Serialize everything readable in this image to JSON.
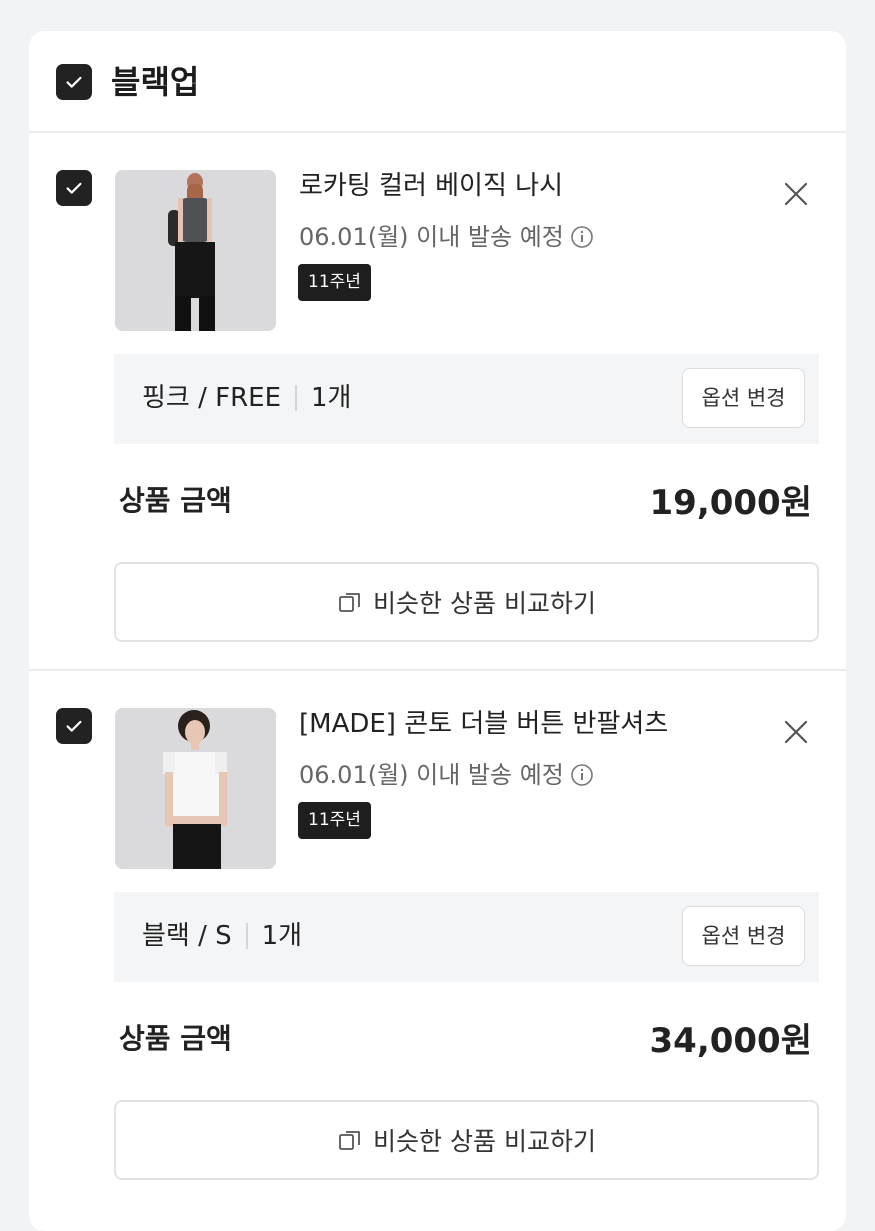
{
  "store": {
    "name": "블랙업",
    "checked": true
  },
  "items": [
    {
      "name": "로카팅 컬러 베이직 나시",
      "shipping": "06.01(월) 이내 발송 예정",
      "badge": "11주년",
      "option": "핑크 / FREE",
      "quantity": "1개",
      "option_button": "옵션 변경",
      "price_label": "상품 금액",
      "price": "19,000원",
      "compare_button": "비슷한 상품 비교하기",
      "checked": true
    },
    {
      "name": "[MADE] 콘토 더블 버튼 반팔셔츠",
      "shipping": "06.01(월) 이내 발송 예정",
      "badge": "11주년",
      "option": "블랙 / S",
      "quantity": "1개",
      "option_button": "옵션 변경",
      "price_label": "상품 금액",
      "price": "34,000원",
      "compare_button": "비슷한 상품 비교하기",
      "checked": true
    }
  ],
  "icons": {
    "checkbox": "check-icon",
    "remove": "close-icon",
    "info": "info-icon",
    "compare": "compare-icon"
  },
  "colors": {
    "checkbox_bg": "#222222",
    "badge_bg": "#1e1e1e",
    "option_bg": "#f4f5f7"
  }
}
